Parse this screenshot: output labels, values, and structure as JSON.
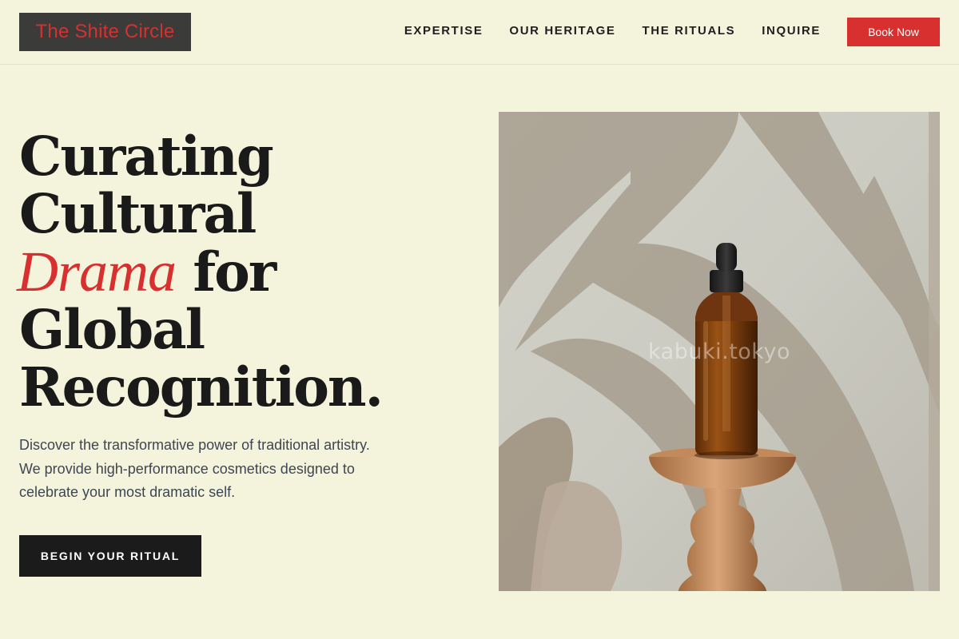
{
  "brand": {
    "name": "The Shite Circle"
  },
  "nav": {
    "items": [
      {
        "label": "EXPERTISE"
      },
      {
        "label": "OUR HERITAGE"
      },
      {
        "label": "THE RITUALS"
      },
      {
        "label": "INQUIRE"
      }
    ],
    "book_label": "Book Now"
  },
  "hero": {
    "headline": {
      "line1": "Curating",
      "line2": "Cultural",
      "accent": "Drama",
      "line3_rest": "for",
      "line4": "Global",
      "line5": "Recognition."
    },
    "lead": "Discover the transformative power of traditional artistry. We provide high-performance cosmetics designed to celebrate your most dramatic self.",
    "cta_label": "BEGIN YOUR RITUAL",
    "image": {
      "watermark": "kabuki.tokyo",
      "alt": "Amber dropper bottle on a wooden pedestal with leaf shadows"
    }
  },
  "colors": {
    "background": "#f4f3dc",
    "accent": "#d8302f",
    "dark": "#1b1b1b",
    "logo_bg": "#3b3b39"
  }
}
